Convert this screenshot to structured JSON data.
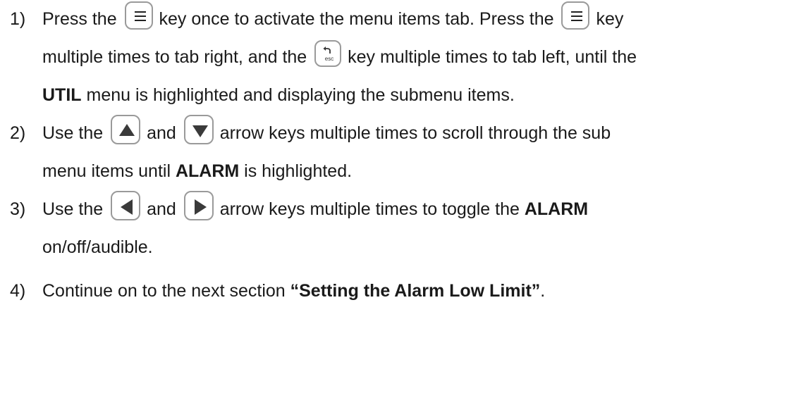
{
  "steps": [
    {
      "num": "1)",
      "l1a": "Press the",
      "l1b": "key once to activate the menu items tab.  Press the",
      "l1c": "key",
      "l2a": "multiple times to tab right, and the",
      "l2b": "key multiple times to tab left, until the",
      "l3bold": "UTIL",
      "l3rest": " menu is highlighted and displaying the submenu items."
    },
    {
      "num": "2)",
      "l1a": "Use the",
      "l1b": "and",
      "l1c": "arrow keys multiple times to scroll through the sub",
      "l2a": "menu items until ",
      "l2bold": "ALARM",
      "l2rest": " is highlighted."
    },
    {
      "num": "3)",
      "l1a": "Use the",
      "l1b": "and",
      "l1c": "arrow keys multiple times to toggle the ",
      "l1bold": "ALARM",
      "l2": "on/off/audible."
    },
    {
      "num": "4)",
      "l1a": "Continue on to the next section ",
      "l1bold": "“Setting the Alarm Low Limit”",
      "l1c": "."
    }
  ],
  "keys": {
    "menu": "menu-icon",
    "esc_label": "esc",
    "up": "up-arrow-icon",
    "down": "down-arrow-icon",
    "left": "left-arrow-icon",
    "right": "right-arrow-icon"
  }
}
